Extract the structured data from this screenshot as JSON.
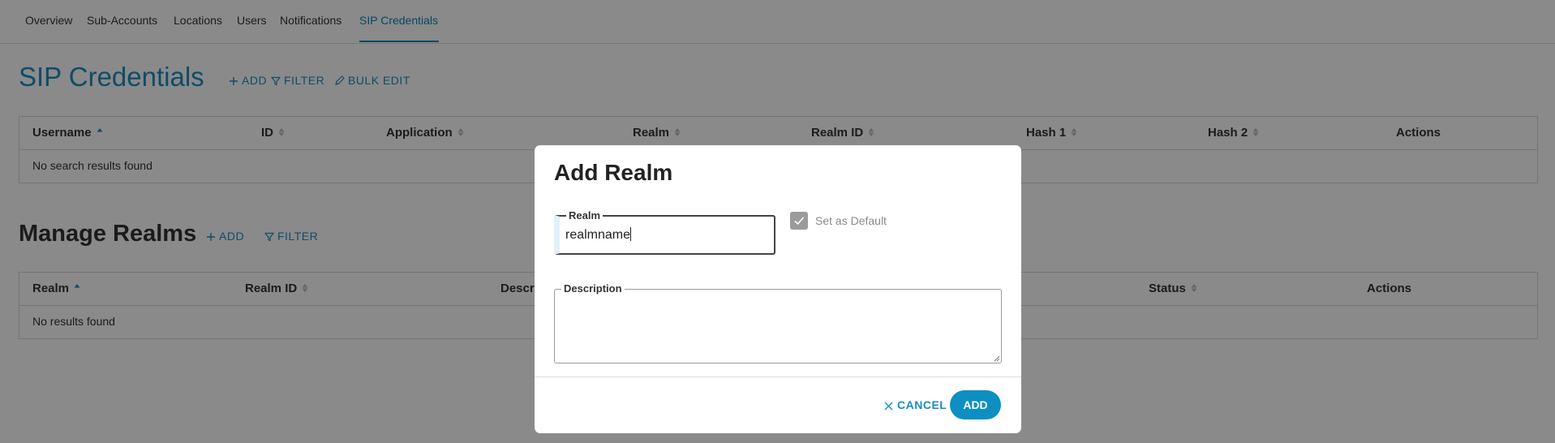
{
  "nav": {
    "tabs": [
      {
        "label": "Overview"
      },
      {
        "label": "Sub-Accounts"
      },
      {
        "label": "Locations"
      },
      {
        "label": "Users"
      },
      {
        "label": "Notifications"
      },
      {
        "label": "SIP Credentials",
        "active": true
      }
    ]
  },
  "sip": {
    "title": "SIP Credentials",
    "add_label": "ADD",
    "filter_label": "FILTER",
    "bulk_edit_label": "BULK EDIT",
    "columns": [
      "Username",
      "ID",
      "Application",
      "Realm",
      "Realm ID",
      "Hash 1",
      "Hash 2",
      "Actions"
    ],
    "empty": "No search results found"
  },
  "realms": {
    "title": "Manage Realms",
    "add_label": "ADD",
    "filter_label": "FILTER",
    "columns": [
      "Realm",
      "Realm ID",
      "Descr",
      "Status",
      "Actions"
    ],
    "empty": "No results found"
  },
  "modal": {
    "title": "Add Realm",
    "realm_label": "Realm",
    "realm_value": "realmname",
    "default_label": "Set as Default",
    "default_checked": true,
    "description_label": "Description",
    "description_value": "",
    "cancel_label": "CANCEL",
    "add_label": "ADD"
  },
  "colors": {
    "accent": "#1a8dc0",
    "button": "#0d8fc4",
    "overlay": "rgba(0,0,0,0.46)"
  }
}
